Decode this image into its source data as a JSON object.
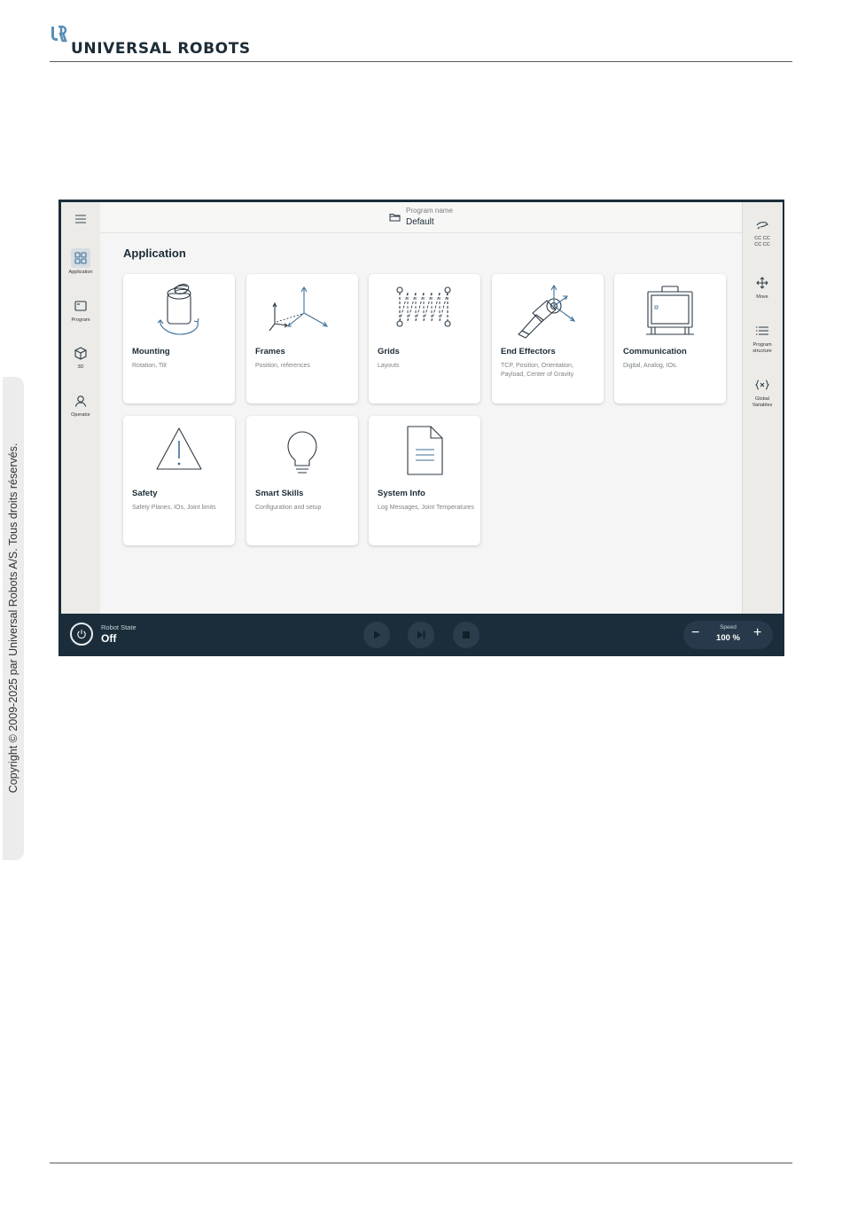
{
  "header": {
    "brand": "UNIVERSAL ROBOTS",
    "logo_mark": "UR"
  },
  "sidebar_note": {
    "copyright": "Copyright © 2009-2025 par Universal Robots A/S. Tous droits réservés."
  },
  "screen": {
    "topbar": {
      "program_label": "Program name",
      "program_value": "Default"
    },
    "left_nav": [
      {
        "label": "Application",
        "icon": "grid-icon",
        "active": true
      },
      {
        "label": "Program",
        "icon": "program-window-icon",
        "active": false
      },
      {
        "label": "3D",
        "icon": "cube-icon",
        "active": false
      },
      {
        "label": "Operator",
        "icon": "user-icon",
        "active": false
      }
    ],
    "right_nav": [
      {
        "label": "CC CC\nCC CC",
        "icon": "hand-guide-icon"
      },
      {
        "label": "Move",
        "icon": "move-arrows-icon"
      },
      {
        "label": "Program\nstructure",
        "icon": "list-icon"
      },
      {
        "label": "Global\nVariables",
        "icon": "variable-braces-icon"
      }
    ],
    "section_title": "Application",
    "cards": [
      {
        "title": "Mounting",
        "desc": "Rotation, Tilt",
        "icon": "mounting-icon"
      },
      {
        "title": "Frames",
        "desc": "Position, references",
        "icon": "frames-icon"
      },
      {
        "title": "Grids",
        "desc": "Layouts",
        "icon": "grids-icon"
      },
      {
        "title": "End Effectors",
        "desc": "TCP, Position, Orientation, Payload, Center of Gravity",
        "icon": "end-effector-icon"
      },
      {
        "title": "Communication",
        "desc": "Digital, Analog, IOs.",
        "icon": "communication-box-icon"
      },
      {
        "title": "Safety",
        "desc": "Safety Planes, IOs, Joint limits",
        "icon": "warning-triangle-icon"
      },
      {
        "title": "Smart Skills",
        "desc": "Configuration and setup",
        "icon": "lightbulb-icon"
      },
      {
        "title": "System Info",
        "desc": "Log Messages, Joint Temperatures",
        "icon": "document-icon"
      }
    ],
    "bottombar": {
      "robot_state_label": "Robot State",
      "robot_state_value": "Off",
      "speed_label": "Speed",
      "speed_value": "100 %"
    }
  }
}
